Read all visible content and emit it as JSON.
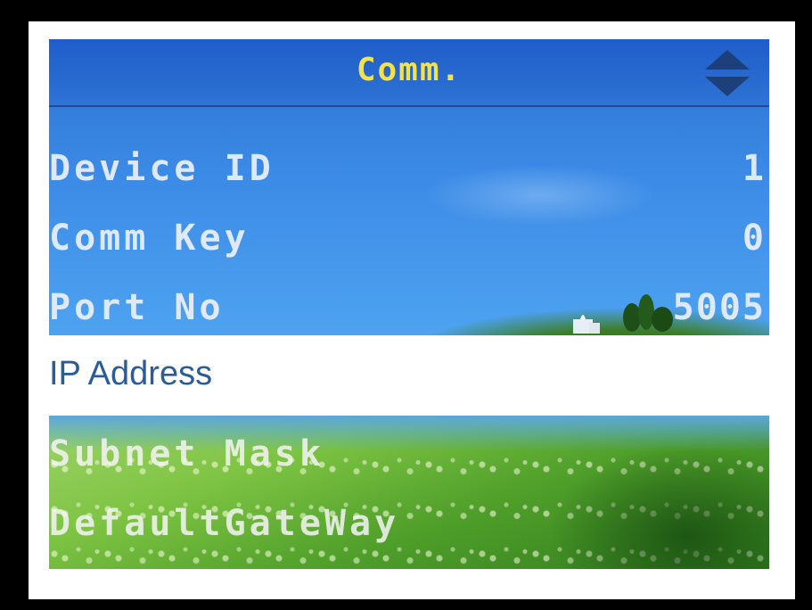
{
  "screen": {
    "title": "Comm.",
    "scroll_icon": "up-down-arrows-icon",
    "menu_items": [
      {
        "label": "Device ID",
        "value": "1"
      },
      {
        "label": "Comm Key",
        "value": "0"
      },
      {
        "label": "Port No",
        "value": "5005"
      },
      {
        "label": "IP Address",
        "value": ""
      },
      {
        "label": "Subnet Mask",
        "value": ""
      },
      {
        "label": "DefaultGateWay",
        "value": ""
      }
    ],
    "selected_index": 3,
    "colors": {
      "title": "#f3e24a",
      "selected_text": "#2a5c98",
      "item_text": "#ebf0fa"
    }
  }
}
